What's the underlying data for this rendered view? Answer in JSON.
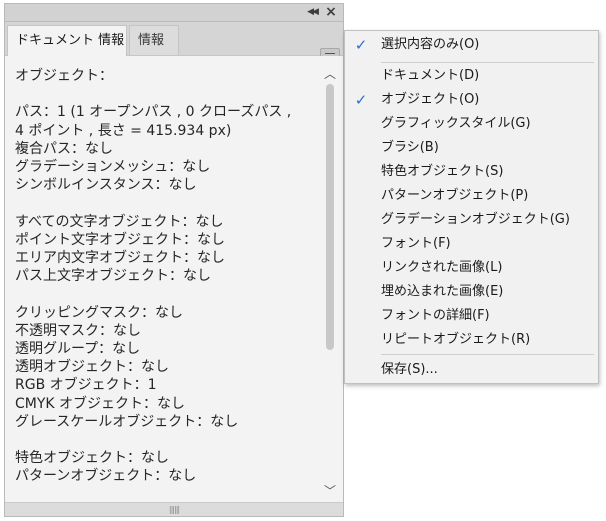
{
  "panel": {
    "collapse_icon": "double-chevron-left",
    "close_icon": "close-x",
    "tabs": [
      {
        "label": "ドキュメント 情報",
        "active": true
      },
      {
        "label": "情報",
        "active": false
      }
    ],
    "menu_icon": "hamburger",
    "info_text": "オブジェクト：\n\nパス：1 (1 オープンパス , 0 クローズパス ,\n4 ポイント , 長さ = 415.934 px)\n複合パス：なし\nグラデーションメッシュ：なし\nシンボルインスタンス：なし\n\nすべての文字オブジェクト：なし\nポイント文字オブジェクト：なし\nエリア内文字オブジェクト：なし\nパス上文字オブジェクト：なし\n\nクリッピングマスク：なし\n不透明マスク：なし\n透明グループ：なし\n透明オブジェクト：なし\nRGB オブジェクト：1\nCMYK オブジェクト：なし\nグレースケールオブジェクト：なし\n\n特色オブジェクト：なし\nパターンオブジェクト：なし"
  },
  "menu": {
    "items": [
      {
        "label": "選択内容のみ(O)",
        "checked": true
      },
      {
        "label": "ドキュメント(D)",
        "checked": false
      },
      {
        "label": "オブジェクト(O)",
        "checked": true
      },
      {
        "label": "グラフィックスタイル(G)",
        "checked": false
      },
      {
        "label": "ブラシ(B)",
        "checked": false
      },
      {
        "label": "特色オブジェクト(S)",
        "checked": false
      },
      {
        "label": "パターンオブジェクト(P)",
        "checked": false
      },
      {
        "label": "グラデーションオブジェクト(G)",
        "checked": false
      },
      {
        "label": "フォント(F)",
        "checked": false
      },
      {
        "label": "リンクされた画像(L)",
        "checked": false
      },
      {
        "label": "埋め込まれた画像(E)",
        "checked": false
      },
      {
        "label": "フォントの詳細(F)",
        "checked": false
      },
      {
        "label": "リピートオブジェクト(R)",
        "checked": false
      },
      {
        "label": "保存(S)...",
        "checked": false
      }
    ],
    "check_color": "#2f6fd0"
  }
}
